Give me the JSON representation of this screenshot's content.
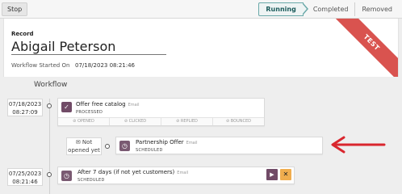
{
  "toolbar": {
    "stop_label": "Stop",
    "stages": [
      "Running",
      "Completed",
      "Removed"
    ],
    "active_stage": "Running"
  },
  "record": {
    "label": "Record",
    "name": "Abigail Peterson",
    "started_label": "Workflow Started On",
    "started_value": "07/18/2023 08:21:46",
    "ribbon": "TEST"
  },
  "workflow": {
    "title": "Workflow",
    "activities": [
      {
        "date": "07/18/2023",
        "time": "08:27:09",
        "title": "Offer free catalog",
        "type": "Email",
        "status": "PROCESSED",
        "stats": [
          "OPENED",
          "CLICKED",
          "REPLIED",
          "BOUNCED"
        ]
      },
      {
        "pending_label_1": "Not",
        "pending_label_2": "opened yet",
        "title": "Partnership Offer",
        "type": "Email",
        "status": "SCHEDULED"
      },
      {
        "date": "07/25/2023",
        "time": "08:21:46",
        "title": "After 7 days (if not yet customers)",
        "type": "Email",
        "status": "SCHEDULED"
      }
    ]
  },
  "colors": {
    "primary": "#714b67",
    "ribbon": "#d9534f",
    "arrow": "#d9262e",
    "cancel": "#f0ad4e"
  }
}
